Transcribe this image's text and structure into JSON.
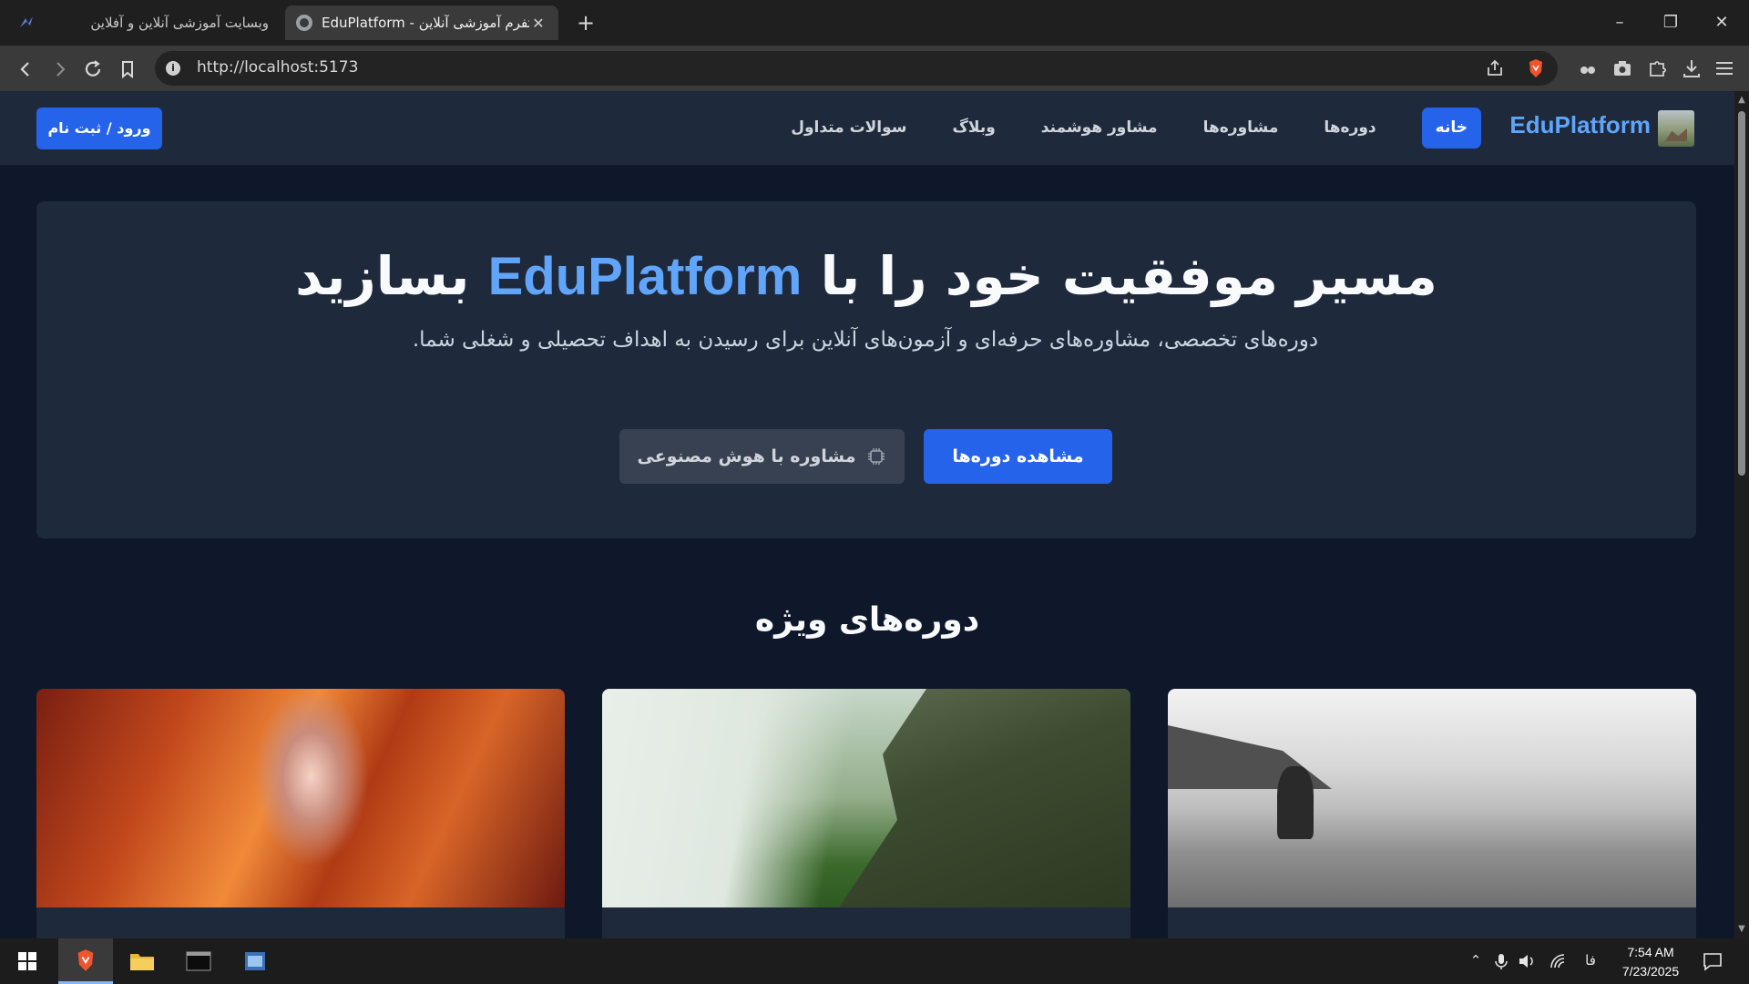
{
  "browser": {
    "tabs": [
      {
        "title": "وبسایت آموزشی آنلاین و آفلاین",
        "active": false
      },
      {
        "title": "EduPlatform - پلتفرم آموزشی آنلاین",
        "active": true
      }
    ],
    "url": "http://localhost:5173"
  },
  "site": {
    "brand": "EduPlatform",
    "nav": [
      {
        "label": "خانه",
        "active": true
      },
      {
        "label": "دوره‌ها",
        "active": false
      },
      {
        "label": "مشاوره‌ها",
        "active": false
      },
      {
        "label": "مشاور هوشمند",
        "active": false
      },
      {
        "label": "وبلاگ",
        "active": false
      },
      {
        "label": "سوالات متداول",
        "active": false
      }
    ],
    "login_label": "ورود / ثبت نام"
  },
  "hero": {
    "title_before": "مسیر موفقیت خود را با ",
    "title_highlight": "EduPlatform",
    "title_after": " بسازید",
    "subtitle": "دوره‌های تخصصی، مشاوره‌های حرفه‌ای و آزمون‌های آنلاین برای رسیدن به اهداف تحصیلی و شغلی شما.",
    "primary_button": "مشاهده دوره‌ها",
    "secondary_button": "مشاوره با هوش مصنوعی"
  },
  "featured": {
    "title": "دوره‌های ویژه",
    "cards": [
      {
        "image": "canyon"
      },
      {
        "image": "cliff"
      },
      {
        "image": "beach-surfer"
      }
    ]
  },
  "taskbar": {
    "time": "7:54 AM",
    "date": "7/23/2025",
    "language": "فا"
  },
  "colors": {
    "accent": "#2563eb",
    "brand_text": "#60a5fa",
    "page_bg": "#0f172a",
    "panel_bg": "#1e293b"
  }
}
